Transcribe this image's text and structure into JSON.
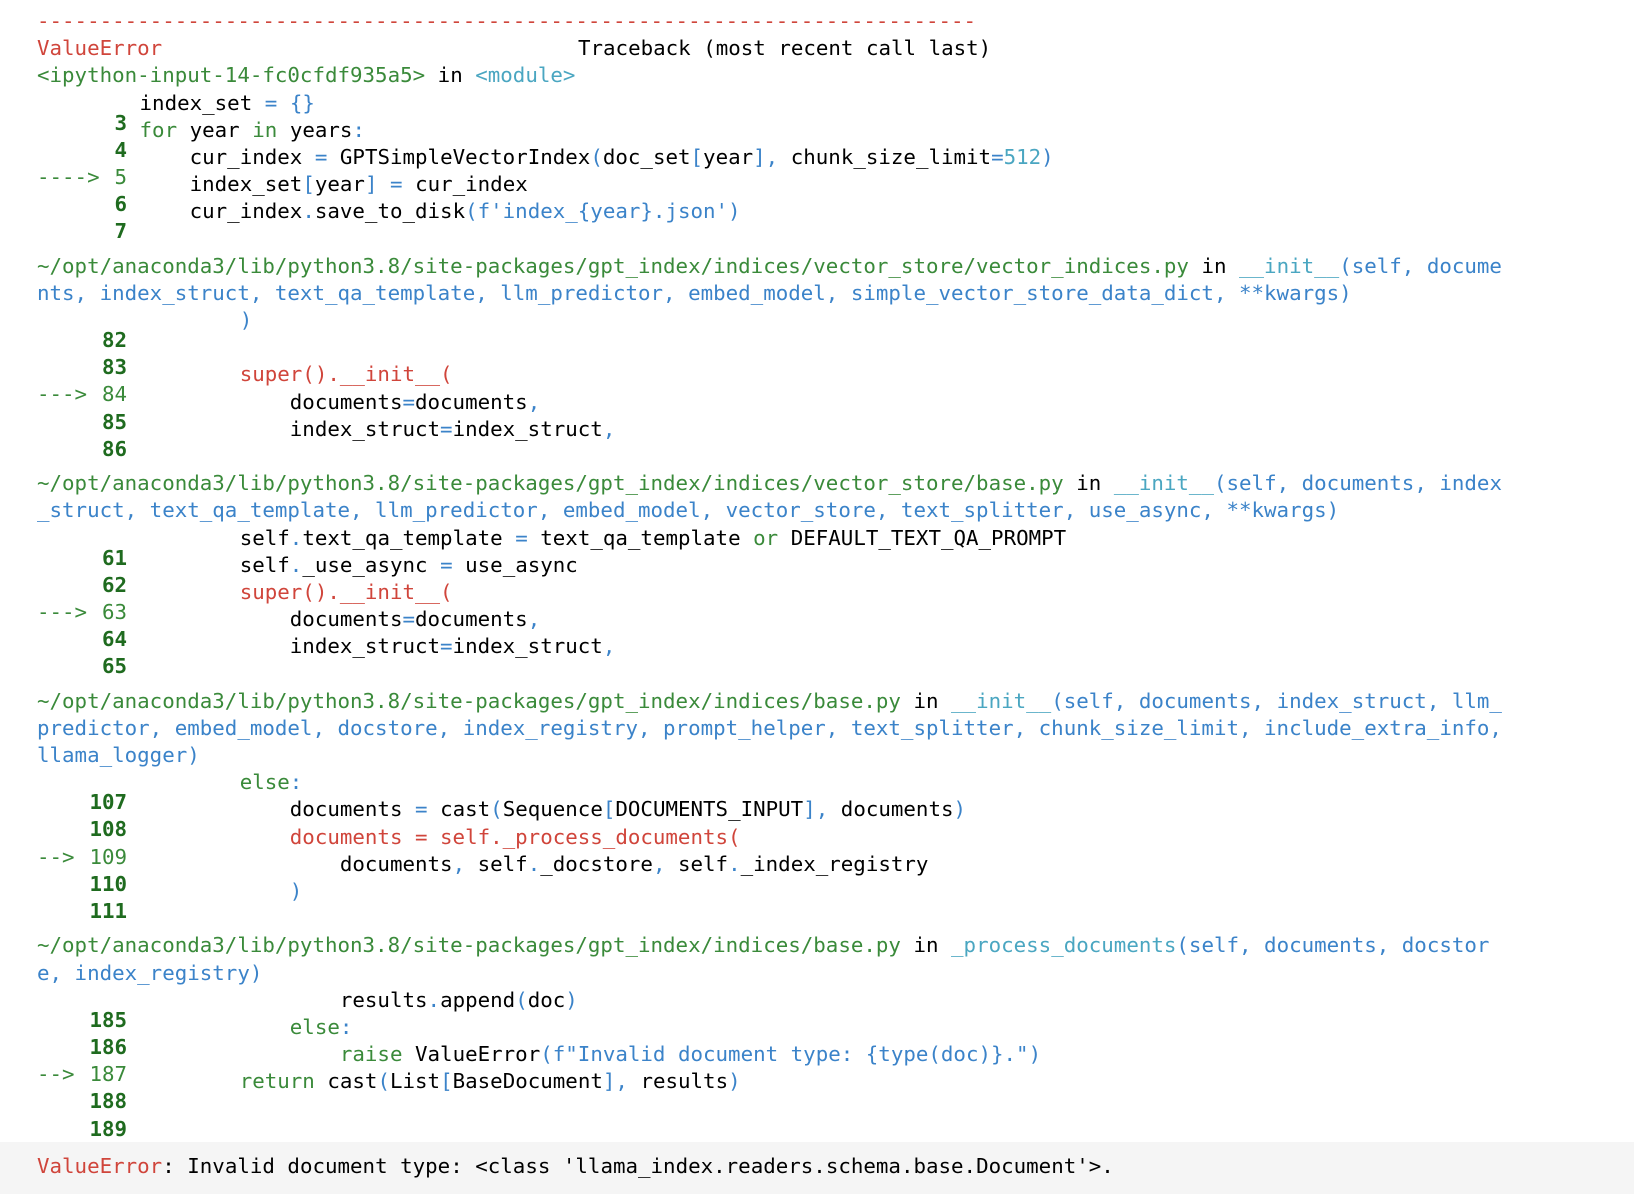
{
  "traceback": {
    "separator": "---------------------------------------------------------------------------",
    "header_error": "ValueError",
    "header_title": "Traceback (most recent call last)",
    "frames": [
      {
        "location": "<ipython-input-14-fc0cfdf935a5>",
        "function": "<module>",
        "lines": [
          {
            "marker": "",
            "num": "3",
            "code": "index_set = {}"
          },
          {
            "marker": "",
            "num": "4",
            "code": "for year in years:"
          },
          {
            "marker": "---->",
            "num": "5",
            "code": "    cur_index = GPTSimpleVectorIndex(doc_set[year], chunk_size_limit=512)"
          },
          {
            "marker": "",
            "num": "6",
            "code": "    index_set[year] = cur_index"
          },
          {
            "marker": "",
            "num": "7",
            "code": "    cur_index.save_to_disk(f'index_{year}.json')"
          }
        ]
      },
      {
        "location": "~/opt/anaconda3/lib/python3.8/site-packages/gpt_index/indices/vector_store/vector_indices.py",
        "function": "__init__",
        "args_line1": "(self, docume",
        "args_line2": "nts, index_struct, text_qa_template, llm_predictor, embed_model, simple_vector_store_data_dict, **kwargs)",
        "lines": [
          {
            "marker": "",
            "num": "82",
            "code": "        )"
          },
          {
            "marker": "",
            "num": "83",
            "code": ""
          },
          {
            "marker": "--->",
            "num": "84",
            "code": "        super().__init__("
          },
          {
            "marker": "",
            "num": "85",
            "code": "            documents=documents,"
          },
          {
            "marker": "",
            "num": "86",
            "code": "            index_struct=index_struct,"
          }
        ]
      },
      {
        "location": "~/opt/anaconda3/lib/python3.8/site-packages/gpt_index/indices/vector_store/base.py",
        "function": "__init__",
        "args_line1": "(self, documents, index",
        "args_line2": "_struct, text_qa_template, llm_predictor, embed_model, vector_store, text_splitter, use_async, **kwargs)",
        "lines": [
          {
            "marker": "",
            "num": "61",
            "code": "        self.text_qa_template = text_qa_template or DEFAULT_TEXT_QA_PROMPT"
          },
          {
            "marker": "",
            "num": "62",
            "code": "        self._use_async = use_async"
          },
          {
            "marker": "--->",
            "num": "63",
            "code": "        super().__init__("
          },
          {
            "marker": "",
            "num": "64",
            "code": "            documents=documents,"
          },
          {
            "marker": "",
            "num": "65",
            "code": "            index_struct=index_struct,"
          }
        ]
      },
      {
        "location": "~/opt/anaconda3/lib/python3.8/site-packages/gpt_index/indices/base.py",
        "function": "__init__",
        "args_line1": "(self, documents, index_struct, llm_",
        "args_line2": "predictor, embed_model, docstore, index_registry, prompt_helper, text_splitter, chunk_size_limit, include_extra_info,",
        "args_line3": "llama_logger)",
        "lines": [
          {
            "marker": "",
            "num": "107",
            "code": "        else:"
          },
          {
            "marker": "",
            "num": "108",
            "code": "            documents = cast(Sequence[DOCUMENTS_INPUT], documents)"
          },
          {
            "marker": "-->",
            "num": "109",
            "code": "            documents = self._process_documents("
          },
          {
            "marker": "",
            "num": "110",
            "code": "                documents, self._docstore, self._index_registry"
          },
          {
            "marker": "",
            "num": "111",
            "code": "            )"
          }
        ]
      },
      {
        "location": "~/opt/anaconda3/lib/python3.8/site-packages/gpt_index/indices/base.py",
        "function": "_process_documents",
        "args_line1": "(self, documents, docstor",
        "args_line2": "e, index_registry)",
        "lines": [
          {
            "marker": "",
            "num": "185",
            "code": "                results.append(doc)"
          },
          {
            "marker": "",
            "num": "186",
            "code": "            else:"
          },
          {
            "marker": "-->",
            "num": "187",
            "code": "                raise ValueError(f\"Invalid document type: {type(doc)}.\")"
          },
          {
            "marker": "",
            "num": "188",
            "code": "        return cast(List[BaseDocument], results)"
          },
          {
            "marker": "",
            "num": "189",
            "code": ""
          }
        ]
      }
    ],
    "final_error_type": "ValueError",
    "final_error_message": ": Invalid document type: <class 'llama_index.readers.schema.base.Document'>."
  },
  "colors": {
    "error_red": "#d0453b",
    "path_green": "#3a8a3a",
    "lineno_green": "#1f6b1f",
    "func_cyan": "#4aa6c1",
    "args_blue": "#3b83c9",
    "footer_bg": "#f5f5f5"
  }
}
